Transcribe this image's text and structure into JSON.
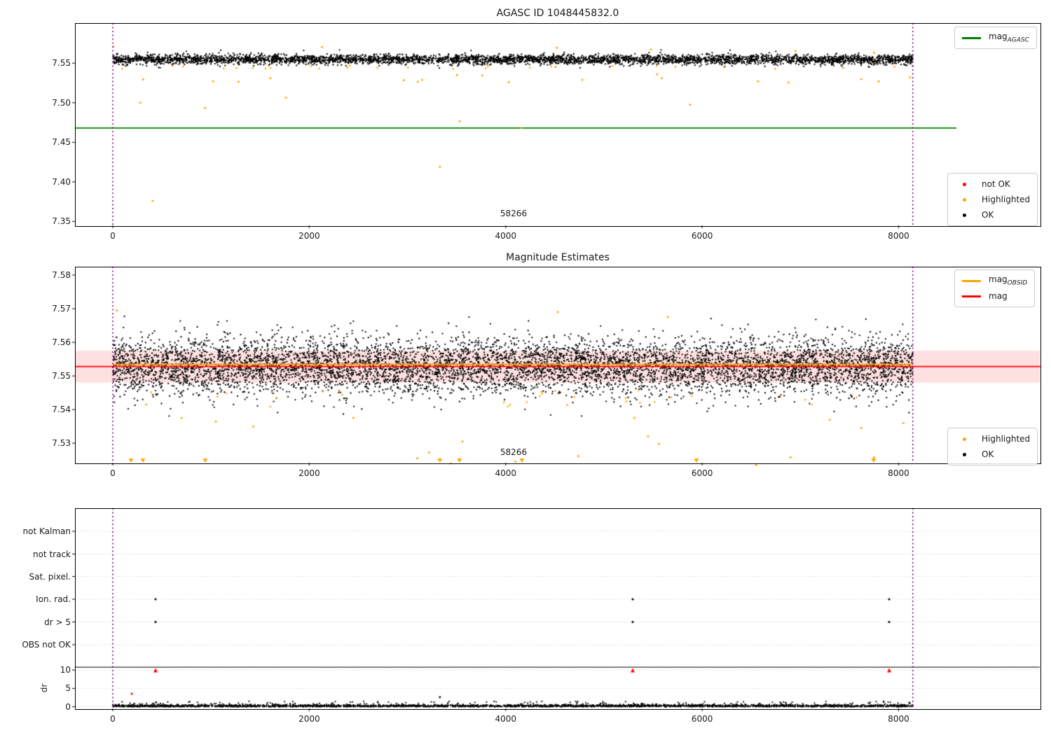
{
  "figure": {
    "background": "#ffffff"
  },
  "chart_data": [
    {
      "type": "scatter",
      "title": "AGASC ID 1048445832.0",
      "xlim": [
        -385,
        9445
      ],
      "ylim": [
        7.345,
        7.6
      ],
      "x_ticks": {
        "values": [
          0,
          2000,
          4000,
          6000,
          8000
        ],
        "labels": [
          "0",
          "2000",
          "4000",
          "6000",
          "8000"
        ]
      },
      "y_ticks": {
        "values": [
          7.35,
          7.4,
          7.45,
          7.5,
          7.55
        ],
        "labels": [
          "7.35",
          "7.40",
          "7.45",
          "7.50",
          "7.55"
        ]
      },
      "grid": false,
      "vlines": {
        "x": [
          0,
          8145
        ],
        "color": "#800080",
        "style": "dotted"
      },
      "hline": {
        "value": 7.468,
        "x_start": -385,
        "x_end": 8590,
        "color": "#008000"
      },
      "legend_line": {
        "position": "upper right",
        "items": [
          {
            "label": "mag",
            "sub": "AGASC",
            "color": "#008000"
          }
        ]
      },
      "legend_markers": {
        "position": "lower right",
        "items": [
          {
            "label": "not OK",
            "color": "#ff0000"
          },
          {
            "label": "Highlighted",
            "color": "#ffa500"
          },
          {
            "label": "OK",
            "color": "#000000"
          }
        ]
      },
      "annotation": {
        "text": "58266",
        "x": 4080,
        "y": 7.359
      },
      "cloud": {
        "n": 4200,
        "x_range": [
          0,
          8145
        ],
        "mean": 7.5547,
        "std": 0.003,
        "clip": [
          7.5428,
          7.5692
        ],
        "seed": 42,
        "color": "#000000"
      },
      "halo": {
        "n": 160,
        "x_range": [
          0,
          8145
        ],
        "mean": 7.5547,
        "std": 0.0052,
        "clip": [
          7.5428,
          7.5692
        ],
        "seed": 43,
        "color": "#000000"
      },
      "highlighted_band": {
        "n": 28,
        "x_range": [
          0,
          8145
        ],
        "y_range": [
          7.5425,
          7.5468
        ],
        "seed": 7,
        "color": "#ffa500"
      },
      "highlighted_points": [
        [
          280,
          7.5
        ],
        [
          405,
          7.376
        ],
        [
          940,
          7.4935
        ],
        [
          1762,
          7.5065
        ],
        [
          3330,
          7.419
        ],
        [
          3532,
          7.4765
        ],
        [
          4160,
          7.4685
        ],
        [
          5878,
          7.4975
        ],
        [
          310,
          7.5295
        ],
        [
          1020,
          7.527
        ],
        [
          1280,
          7.5265
        ],
        [
          1604,
          7.531
        ],
        [
          2962,
          7.5285
        ],
        [
          3105,
          7.5265
        ],
        [
          3150,
          7.529
        ],
        [
          3503,
          7.535
        ],
        [
          3762,
          7.5345
        ],
        [
          4032,
          7.526
        ],
        [
          4780,
          7.529
        ],
        [
          5541,
          7.536
        ],
        [
          5590,
          7.531
        ],
        [
          6570,
          7.527
        ],
        [
          6878,
          7.5255
        ],
        [
          7620,
          7.53
        ],
        [
          7798,
          7.527
        ],
        [
          8118,
          7.532
        ],
        [
          5,
          7.571
        ],
        [
          2130,
          7.5705
        ],
        [
          4520,
          7.5695
        ],
        [
          5480,
          7.5672
        ],
        [
          6950,
          7.5655
        ],
        [
          7750,
          7.563
        ]
      ]
    },
    {
      "type": "scatter",
      "title": "Magnitude Estimates",
      "xlim": [
        -385,
        9445
      ],
      "ylim": [
        7.524,
        7.5825
      ],
      "x_ticks": {
        "values": [
          0,
          2000,
          4000,
          6000,
          8000
        ],
        "labels": [
          "0",
          "2000",
          "4000",
          "6000",
          "8000"
        ]
      },
      "y_ticks": {
        "values": [
          7.53,
          7.54,
          7.55,
          7.56,
          7.57,
          7.58
        ],
        "labels": [
          "7.53",
          "7.54",
          "7.55",
          "7.56",
          "7.57",
          "7.58"
        ]
      },
      "band": {
        "y0": 7.548,
        "y1": 7.5575,
        "color": "rgba(255,0,0,0.12)"
      },
      "lines": [
        {
          "label": "mag",
          "sub": "OBSID",
          "value": 7.5535,
          "x_start": 0,
          "x_end": 8145,
          "color": "#ffa500"
        },
        {
          "label": "mag",
          "sub": "",
          "value": 7.5527,
          "x_start": -385,
          "x_end": 9445,
          "color": "#ff0000"
        }
      ],
      "vlines": {
        "x": [
          0,
          8145
        ],
        "color": "#800080",
        "style": "dotted"
      },
      "legend_lines": {
        "position": "upper right",
        "items": [
          {
            "label": "mag",
            "sub": "OBSID",
            "color": "#ffa500"
          },
          {
            "label": "mag",
            "sub": "",
            "color": "#ff0000"
          }
        ]
      },
      "legend_markers": {
        "position": "lower right",
        "items": [
          {
            "label": "Highlighted",
            "color": "#ffa500"
          },
          {
            "label": "OK",
            "color": "#000000"
          }
        ]
      },
      "annotation": {
        "text": "58266",
        "x": 4080,
        "y": 7.5273
      },
      "cloud": {
        "n": 6500,
        "x_range": [
          0,
          8145
        ],
        "mean": 7.553,
        "std": 0.004,
        "clip": [
          7.5383,
          7.5678
        ],
        "seed": 11,
        "color": "#000000"
      },
      "halo": {
        "n": 420,
        "x_range": [
          0,
          8145
        ],
        "mean": 7.553,
        "std": 0.0072,
        "clip": [
          7.5378,
          7.5683
        ],
        "seed": 12,
        "color": "#000000"
      },
      "highlighted_band": {
        "n": 30,
        "x_range": [
          0,
          8145
        ],
        "y_range": [
          7.5405,
          7.5458
        ],
        "seed": 9,
        "color": "#ffa500"
      },
      "highlighted_points": [
        [
          340,
          7.5415
        ],
        [
          700,
          7.5375
        ],
        [
          1050,
          7.5365
        ],
        [
          1430,
          7.535
        ],
        [
          2450,
          7.5375
        ],
        [
          3100,
          7.5255
        ],
        [
          3220,
          7.5272
        ],
        [
          3440,
          7.524
        ],
        [
          3560,
          7.5305
        ],
        [
          4100,
          7.5245
        ],
        [
          4740,
          7.5262
        ],
        [
          5310,
          7.5375
        ],
        [
          5450,
          7.532
        ],
        [
          5560,
          7.5298
        ],
        [
          6550,
          7.5235
        ],
        [
          6900,
          7.5258
        ],
        [
          7300,
          7.537
        ],
        [
          7620,
          7.5345
        ],
        [
          7750,
          7.5258
        ],
        [
          8050,
          7.536
        ],
        [
          40,
          7.5695
        ],
        [
          4530,
          7.569
        ],
        [
          5650,
          7.5675
        ]
      ],
      "clipped_low_triangles_x": [
        185,
        307,
        941,
        3330,
        3530,
        4166,
        5942,
        7746
      ]
    },
    {
      "type": "scatter",
      "title": "",
      "xlim": [
        -385,
        9445
      ],
      "x_ticks": {
        "values": [
          0,
          2000,
          4000,
          6000,
          8000
        ],
        "labels": [
          "0",
          "2000",
          "4000",
          "6000",
          "8000"
        ]
      },
      "categories": [
        "not Kalman",
        "not track",
        "Sat. pixel.",
        "Ion. rad.",
        "dr > 5",
        "OBS not OK"
      ],
      "dr_ticks": {
        "values": [
          10,
          5,
          0
        ],
        "labels": [
          "10",
          "5",
          "0"
        ]
      },
      "ylabel": "dr",
      "grid": true,
      "grid_color": "#c9c9c9",
      "threshold_line": {
        "dr": 10.8,
        "color": "#000000"
      },
      "vlines": {
        "x": [
          0,
          8145
        ],
        "color": "#800080",
        "style": "dotted"
      },
      "flag_points": {
        "color": "#000000",
        "points": [
          [
            435,
            "Ion. rad."
          ],
          [
            435,
            "dr > 5"
          ],
          [
            5293,
            "Ion. rad."
          ],
          [
            5293,
            "dr > 5"
          ],
          [
            7904,
            "Ion. rad."
          ],
          [
            7904,
            "dr > 5"
          ]
        ]
      },
      "red_clipped_at_10_x": [
        435,
        5293,
        7904
      ],
      "red_dr_points": [
        [
          193,
          3.55
        ]
      ],
      "dr_spikes": [
        [
          3330,
          2.6
        ],
        [
          440,
          1.2
        ],
        [
          6850,
          1.1
        ]
      ],
      "baseline": {
        "n": 2600,
        "x_range": [
          0,
          8145
        ],
        "abs_std": 0.28,
        "bump_n": 140,
        "bump_range": [
          0.4,
          1.5
        ],
        "seed": 5,
        "color": "#000000"
      }
    }
  ]
}
